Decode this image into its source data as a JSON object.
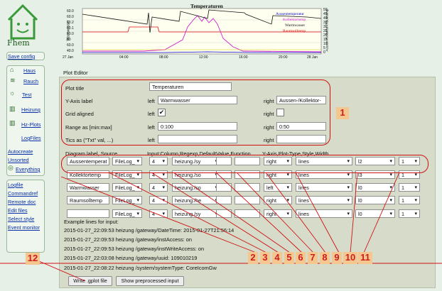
{
  "sidebar": {
    "logo_text": "Fhem",
    "links": [
      "Save config",
      "Haus",
      "Rauch",
      "Test",
      "Heizung",
      "Hz-Plots",
      "LogFiles",
      "Autocreate",
      "Unsorted",
      "Everything",
      "Logfile",
      "Commandref",
      "Remote doc",
      "Edit files",
      "Select style",
      "Event monitor"
    ]
  },
  "plot": {
    "title": "Temperaturen",
    "yaxis_left_ticks": [
      "60.0",
      "60.0",
      "60.2",
      "60.1",
      "60.0",
      "80",
      "60.0",
      "40.0"
    ],
    "yaxis_left_label": "Warmwasser",
    "yaxis_right_ticks": [
      "50",
      "45",
      "40",
      "35",
      "30",
      "25",
      "20",
      "15",
      "10",
      "5",
      "0"
    ],
    "yaxis_right_label": "Aussen-/Kollektor-/Raumtemp",
    "xaxis_ticks": [
      "27 Jan",
      "04:00",
      "08:00",
      "12:00",
      "16:00",
      "20:00",
      "28 Jan"
    ],
    "legend": [
      {
        "name": "Aussentemperatur",
        "color": "#0000cc"
      },
      {
        "name": "Kollektortemp",
        "color": "#cc22cc"
      },
      {
        "name": "Warmwasser",
        "color": "#111111"
      },
      {
        "name": "Raumsolltemp",
        "color": "#dd1111"
      }
    ]
  },
  "editor": {
    "heading": "Plot Editor",
    "labels": {
      "plot_title": "Plot title",
      "yaxis": "Y-Axis label",
      "grid": "Grid aligned",
      "range": "Range as [min:max]",
      "tics": "Tics as (\"Txt\" val, ...)",
      "left": "left",
      "right": "right",
      "diagram_header": "Diagram label, Source",
      "input_header": "Input:Column,Regexp,DefaultValue,Function",
      "yaxis_header": "Y-Axis,Plot-Type,Style,Width"
    },
    "values": {
      "plot_title": "Temperaturen",
      "yaxis_left": "Warmwasser",
      "yaxis_right": "Aussen-/Kollektor-",
      "range_left": "0:100",
      "range_right": "0:50"
    },
    "rows": [
      {
        "label": "Aussentemperat",
        "source": "FileLog_",
        "col": "4",
        "regexp": "heizung./sy",
        "yaxis": "right",
        "type": "lines",
        "style": "l2",
        "width": "1"
      },
      {
        "label": "Kollektortemp",
        "source": "FileLog_",
        "col": "4",
        "regexp": "heizung./so",
        "yaxis": "right",
        "type": "lines",
        "style": "l3",
        "width": "1"
      },
      {
        "label": "Warmwasser",
        "source": "FileLog_",
        "col": "4",
        "regexp": "heizung./so",
        "yaxis": "left",
        "type": "lines",
        "style": "l0",
        "width": "1"
      },
      {
        "label": "Raumsolltemp",
        "source": "FileLog_",
        "col": "4",
        "regexp": "heizung./he",
        "yaxis": "right",
        "type": "lines",
        "style": "l0",
        "width": "1"
      },
      {
        "label": "",
        "source": "FileLog_",
        "col": "4",
        "regexp": "heizung./sy",
        "yaxis": "right",
        "type": "lines",
        "style": "l0",
        "width": "1"
      }
    ],
    "example_header": "Example lines for input:",
    "example_lines": [
      "2015-01-27_22:09:53 heizung /gateway/DateTime: 2015-01-27T21:56:14",
      "2015-01-27_22:09:53 heizung /gateway/instAccess: on",
      "2015-01-27_22:09:53 heizung /gateway/instWriteAccess: on",
      "2015-01-27_22:03:08 heizung /gateway/uuid: 109010219",
      "2015-01-27_22:08:22 heizung /system/systemType: CoreIcomGw"
    ],
    "buttons": {
      "write": "Write .gplot file",
      "show": "Show preprocessed input"
    }
  },
  "annotations": [
    "1",
    "2",
    "3",
    "4",
    "5",
    "6",
    "7",
    "8",
    "9",
    "10",
    "11",
    "12"
  ]
}
